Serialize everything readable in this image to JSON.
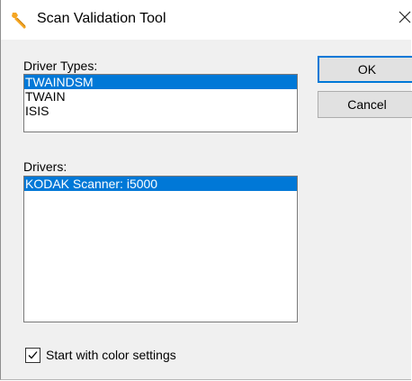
{
  "window": {
    "title": "Scan Validation Tool",
    "app_icon": "wrench-icon",
    "close_icon": "close-icon"
  },
  "driver_types": {
    "label": "Driver Types:",
    "items": [
      "TWAINDSM",
      "TWAIN",
      "ISIS"
    ],
    "selected": "TWAINDSM"
  },
  "drivers": {
    "label": "Drivers:",
    "items": [
      "KODAK Scanner: i5000"
    ],
    "selected": "KODAK Scanner: i5000"
  },
  "buttons": {
    "ok_label": "OK",
    "cancel_label": "Cancel"
  },
  "options": {
    "color_settings_label": "Start with color settings",
    "color_settings_checked": true
  },
  "colors": {
    "selection": "#0078d7",
    "dialog_bg": "#f0f0f0",
    "accent_icon": "#f5a623"
  }
}
